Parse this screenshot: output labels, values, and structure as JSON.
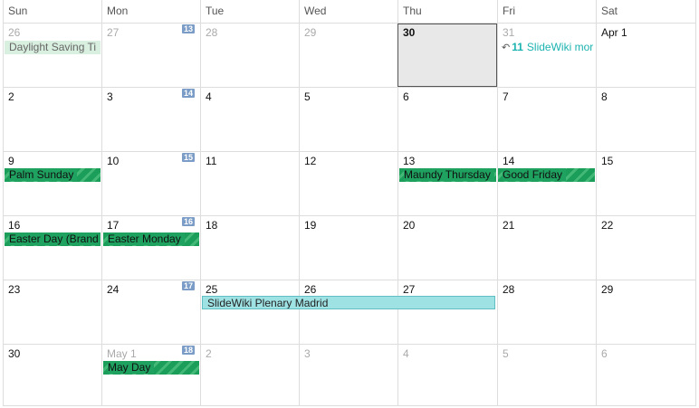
{
  "weekdays": [
    "Sun",
    "Mon",
    "Tue",
    "Wed",
    "Thu",
    "Fri",
    "Sat"
  ],
  "weeks": [
    {
      "week_number": "13",
      "days": [
        {
          "label": "26",
          "other": true
        },
        {
          "label": "27",
          "other": true
        },
        {
          "label": "28",
          "other": true
        },
        {
          "label": "29",
          "other": true
        },
        {
          "label": "30",
          "today": true
        },
        {
          "label": "31",
          "other": true
        },
        {
          "label": "Apr 1"
        }
      ],
      "events": [
        {
          "text": "Daylight Saving Ti",
          "style": "light"
        },
        {
          "text": "SlideWiki mor",
          "count": "11",
          "icon": "reply-icon",
          "style": "inline"
        }
      ]
    },
    {
      "week_number": "14",
      "days": [
        {
          "label": "2"
        },
        {
          "label": "3"
        },
        {
          "label": "4"
        },
        {
          "label": "5"
        },
        {
          "label": "6"
        },
        {
          "label": "7"
        },
        {
          "label": "8"
        }
      ],
      "events": []
    },
    {
      "week_number": "15",
      "days": [
        {
          "label": "9"
        },
        {
          "label": "10"
        },
        {
          "label": "11"
        },
        {
          "label": "12"
        },
        {
          "label": "13"
        },
        {
          "label": "14"
        },
        {
          "label": "15"
        }
      ],
      "events": [
        {
          "text": "Palm Sunday",
          "style": "green"
        },
        {
          "text": "Maundy Thursday",
          "style": "green"
        },
        {
          "text": "Good Friday",
          "style": "green"
        }
      ]
    },
    {
      "week_number": "16",
      "days": [
        {
          "label": "16"
        },
        {
          "label": "17"
        },
        {
          "label": "18"
        },
        {
          "label": "19"
        },
        {
          "label": "20"
        },
        {
          "label": "21"
        },
        {
          "label": "22"
        }
      ],
      "events": [
        {
          "text": "Easter Day (Brand",
          "style": "green"
        },
        {
          "text": "Easter Monday",
          "style": "green"
        }
      ]
    },
    {
      "week_number": "17",
      "days": [
        {
          "label": "23"
        },
        {
          "label": "24"
        },
        {
          "label": "25"
        },
        {
          "label": "26"
        },
        {
          "label": "27"
        },
        {
          "label": "28"
        },
        {
          "label": "29"
        }
      ],
      "events": [
        {
          "text": "SlideWiki Plenary Madrid",
          "style": "cyan"
        }
      ]
    },
    {
      "week_number": "18",
      "days": [
        {
          "label": "30"
        },
        {
          "label": "May 1",
          "other": true
        },
        {
          "label": "2",
          "other": true
        },
        {
          "label": "3",
          "other": true
        },
        {
          "label": "4",
          "other": true
        },
        {
          "label": "5",
          "other": true
        },
        {
          "label": "6",
          "other": true
        }
      ],
      "events": [
        {
          "text": "May Day",
          "style": "green"
        }
      ]
    }
  ],
  "colors": {
    "holiday_green": "#1fa160",
    "event_cyan": "#9fe2e4",
    "week_badge": "#7a9cc6",
    "today_bg": "#e8e8e8"
  }
}
